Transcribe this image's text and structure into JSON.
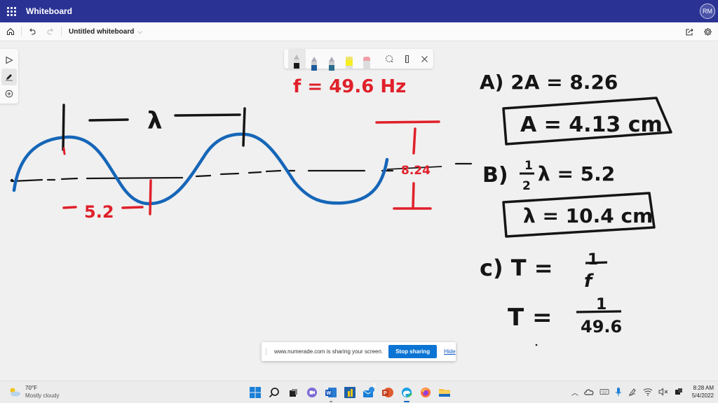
{
  "titlebar": {
    "app_name": "Whiteboard",
    "user_initials": "RM",
    "brand_color": "#2a3394"
  },
  "toolbar": {
    "document_title": "Untitled whiteboard"
  },
  "left_rail": {
    "tools": [
      "select-tool",
      "inking-tool",
      "add-tool"
    ],
    "active": "inking-tool"
  },
  "pen_tray": {
    "pens": [
      {
        "name": "black-pen",
        "color": "#1a1a1a",
        "active": true
      },
      {
        "name": "blue-pen",
        "color": "#1e5a9e",
        "active": false
      },
      {
        "name": "teal-pen",
        "color": "#2a6d8a",
        "active": false
      },
      {
        "name": "highlighter",
        "color": "#f5ee20",
        "active": false
      },
      {
        "name": "eraser",
        "color": "#f0a0a8",
        "active": false
      }
    ],
    "ink_colors": {
      "black": "#151515",
      "blue": "#1666b8",
      "red": "#e0202a"
    }
  },
  "ink": {
    "frequency_label": "f = 49.6 Hz",
    "wavelength_symbol": "λ",
    "half_wavelength_label": "5.2",
    "peak_to_trough_label": "8.24",
    "part_a_line1": "A) 2A = 8.26",
    "part_a_answer": "A = 4.13 cm",
    "part_b_prefix": "B)",
    "part_b_fraction_num": "1",
    "part_b_fraction_den": "2",
    "part_b_rest": "λ = 5.2",
    "part_b_answer": "λ = 10.4 cm",
    "part_c_prefix": "c)  T =",
    "part_c_num": "1",
    "part_c_den": "f",
    "part_c2_prefix": "T =",
    "part_c2_num": "1",
    "part_c2_den": "49.6"
  },
  "share_bar": {
    "message": "www.numerade.com is sharing your screen.",
    "stop_label": "Stop sharing",
    "hide_label": "Hide"
  },
  "taskbar": {
    "weather_temp": "70°F",
    "weather_desc": "Mostly cloudy",
    "apps": [
      "start",
      "search",
      "task-view",
      "teams-chat",
      "word",
      "powerbi",
      "mail",
      "powerpoint",
      "edge",
      "firefox",
      "file-explorer"
    ],
    "mail_badge": "6",
    "time": "8:28 AM",
    "date": "5/4/2022"
  }
}
